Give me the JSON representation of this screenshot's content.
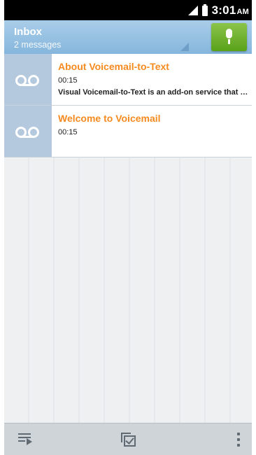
{
  "status_bar": {
    "time": "3:01",
    "ampm": "AM"
  },
  "header": {
    "title": "Inbox",
    "subtitle": "2 messages"
  },
  "messages": [
    {
      "title": "About Voicemail-to-Text",
      "duration": "00:15",
      "preview": "Visual Voicemail-to-Text is an add-on service that converts voicemail to text"
    },
    {
      "title": "Welcome to Voicemail",
      "duration": "00:15",
      "preview": ""
    }
  ],
  "icons": {
    "compose": "mic-icon",
    "message": "voicemail-icon",
    "bottom": [
      "play-list-icon",
      "select-messages-icon",
      "more-options-icon"
    ]
  },
  "colors": {
    "title_orange": "#f58a1f",
    "header_blue": "#9ac3e4",
    "action_green": "#6fb22c"
  }
}
